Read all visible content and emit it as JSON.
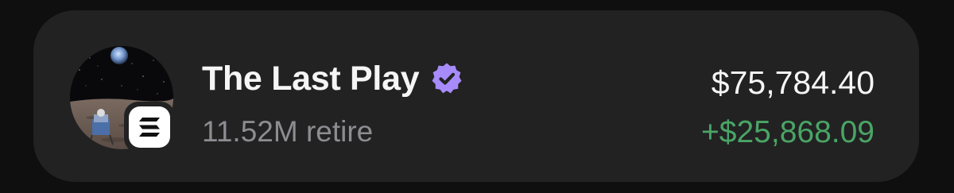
{
  "item": {
    "name": "The Last Play",
    "subtitle": "11.52M retire",
    "value": "$75,784.40",
    "change": "+$25,868.09",
    "verified": true,
    "verified_icon": "verified-badge-icon",
    "chain_icon": "solana-icon",
    "avatar_image": "astronaut-on-moon-with-earth-image"
  },
  "colors": {
    "background": "#0f0f10",
    "card": "#222223",
    "text_primary": "#f5f5f5",
    "text_secondary": "#8d8d91",
    "positive": "#4aa565",
    "verified": "#a78bfa"
  }
}
